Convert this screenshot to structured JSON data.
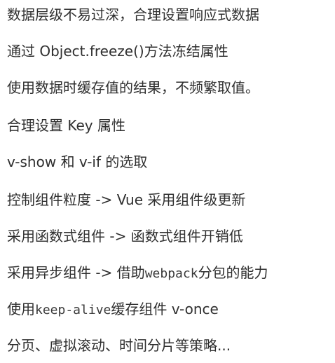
{
  "lines": [
    {
      "text": "数据层级不易过深，合理设置响应式数据"
    },
    {
      "text": "通过 Object.freeze()方法冻结属性"
    },
    {
      "text": "使用数据时缓存值的结果，不频繁取值。"
    },
    {
      "text": "合理设置 Key 属性"
    },
    {
      "text": "v-show 和 v-if 的选取"
    },
    {
      "text": "控制组件粒度 -> Vue 采用组件级更新"
    },
    {
      "text": "采用函数式组件 -> 函数式组件开销低"
    },
    {
      "before": "采用异步组件 -> 借助",
      "code": "webpack",
      "after": "分包的能力"
    },
    {
      "before": "使用",
      "code": "keep-alive",
      "after": "缓存组件 v-once"
    },
    {
      "text": "分页、虚拟滚动、时间分片等策略..."
    }
  ]
}
